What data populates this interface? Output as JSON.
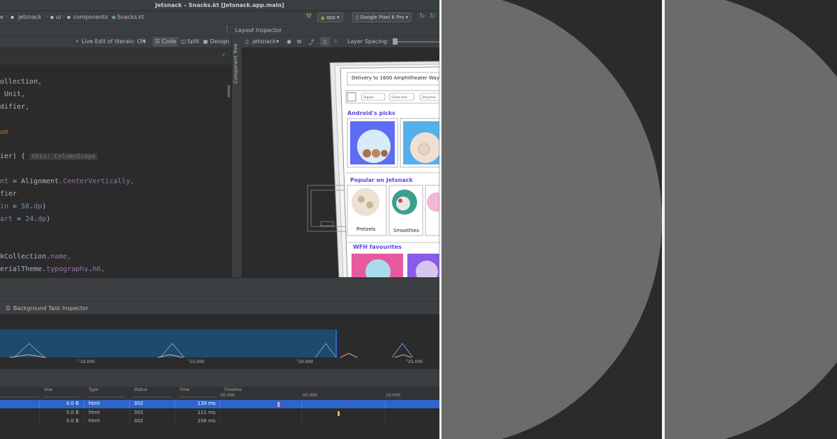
{
  "window": {
    "title": "Jetsnack – Snacks.kt [Jetsnack.app.main]"
  },
  "breadcrumbs": [
    "e",
    "jetsnack",
    "ui",
    "components",
    "Snacks.kt"
  ],
  "run_config": {
    "module": "app",
    "device": "Google Pixel 6 Pro"
  },
  "editor_toolbar": {
    "live_edit": "Live Edit of literals: ON",
    "modes": [
      "Code",
      "Split",
      "Design"
    ]
  },
  "code_lines": [
    {
      "parts": [
        {
          "t": "ollection,",
          "c": ""
        }
      ]
    },
    {
      "parts": [
        {
          "t": " Unit,",
          "c": ""
        }
      ]
    },
    {
      "parts": [
        {
          "t": "difier,",
          "c": ""
        }
      ]
    },
    {
      "parts": [
        {
          "t": "",
          "c": ""
        }
      ]
    },
    {
      "parts": [
        {
          "t": "ue",
          "c": "kw"
        }
      ]
    },
    {
      "parts": [
        {
          "t": "",
          "c": ""
        }
      ]
    },
    {
      "parts": [
        {
          "t": "ier) { ",
          "c": ""
        }
      ],
      "hint": "this: ColumnScope"
    },
    {
      "parts": [
        {
          "t": "",
          "c": ""
        }
      ]
    },
    {
      "parts": [
        {
          "t": "nt",
          "c": "purple"
        },
        {
          "t": " = Alignment.",
          "c": ""
        },
        {
          "t": "CenterVertically",
          "c": "purple"
        },
        {
          "t": ",",
          "c": "kw"
        }
      ]
    },
    {
      "parts": [
        {
          "t": "fier",
          "c": ""
        }
      ]
    },
    {
      "parts": [
        {
          "t": "in",
          "c": "purple"
        },
        {
          "t": " = ",
          "c": ""
        },
        {
          "t": "56",
          "c": "blue"
        },
        {
          "t": ".",
          "c": ""
        },
        {
          "t": "dp",
          "c": "purple"
        },
        {
          "t": ")",
          "c": ""
        }
      ]
    },
    {
      "parts": [
        {
          "t": "art",
          "c": "purple"
        },
        {
          "t": " = ",
          "c": ""
        },
        {
          "t": "24",
          "c": "blue"
        },
        {
          "t": ".",
          "c": ""
        },
        {
          "t": "dp",
          "c": "purple"
        },
        {
          "t": ")",
          "c": ""
        }
      ]
    },
    {
      "parts": [
        {
          "t": "",
          "c": ""
        }
      ]
    },
    {
      "parts": [
        {
          "t": "",
          "c": ""
        }
      ]
    },
    {
      "parts": [
        {
          "t": "kCollection.",
          "c": ""
        },
        {
          "t": "name",
          "c": "purple"
        },
        {
          "t": ",",
          "c": "kw"
        }
      ]
    },
    {
      "parts": [
        {
          "t": "erialTheme.",
          "c": ""
        },
        {
          "t": "typography",
          "c": "purple"
        },
        {
          "t": ".",
          "c": ""
        },
        {
          "t": "h6",
          "c": "purple"
        },
        {
          "t": ",",
          "c": "kw"
        }
      ]
    }
  ],
  "layout_inspector": {
    "title": "Layout Inspector",
    "process": "jetsnack",
    "layer_spacing_label": "Layer Spacing:",
    "side_tab": "Component Tree",
    "preview": {
      "delivery": "Delivery to 1600 Amphitheater Way",
      "chips": [
        "Organic",
        "Gluten-free",
        "Dairy-free"
      ],
      "sections": [
        "Android's picks",
        "Popular on Jetsnack",
        "WFH favourites"
      ],
      "popular_items": [
        "Pretzels",
        "Smoothies"
      ]
    }
  },
  "bottom": {
    "tab": "Background Task Inspector",
    "timeline_ticks": [
      "10.000",
      "15.000",
      "20.000",
      "25.000"
    ],
    "table_headers": [
      "Size",
      "Type",
      "Status",
      "Time",
      "Timeline"
    ],
    "timeline_sub_ticks": [
      "00.000",
      "05.000",
      "10.000"
    ],
    "rows": [
      {
        "size": "0.0 B",
        "type": "html",
        "status": "302",
        "time": "139 ms",
        "selected": true
      },
      {
        "size": "0.0 B",
        "type": "html",
        "status": "302",
        "time": "111 ms",
        "selected": false
      },
      {
        "size": "0.0 B",
        "type": "html",
        "status": "302",
        "time": "106 ms",
        "selected": false
      }
    ]
  },
  "colors": {
    "accent": "#2f65ca",
    "selected_row": "#2f65ca",
    "timeline_area": "#1e4a6b",
    "section_heading": "#5b45e0",
    "disc": "#6b6b6b"
  }
}
